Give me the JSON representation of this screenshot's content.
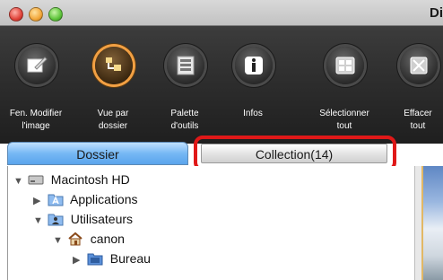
{
  "window": {
    "title": "Di"
  },
  "toolbar": {
    "items": [
      {
        "label": "Fen. Modifier\nl'image",
        "icon": "edit-image-icon"
      },
      {
        "label": "Vue par\ndossier",
        "icon": "folder-view-icon"
      },
      {
        "label": "Palette\nd'outils",
        "icon": "tool-palette-icon"
      },
      {
        "label": "Infos",
        "icon": "info-icon"
      },
      {
        "label": "Sélectionner\ntout",
        "icon": "select-all-icon"
      },
      {
        "label": "Effacer\ntout",
        "icon": "clear-all-icon"
      }
    ]
  },
  "tabs": [
    {
      "label": "Dossier"
    },
    {
      "label": "Collection(14)"
    }
  ],
  "tree": [
    {
      "label": "Macintosh HD",
      "icon": "hard-drive-icon",
      "expanded": true
    },
    {
      "label": "Applications",
      "icon": "applications-folder-icon",
      "expanded": false
    },
    {
      "label": "Utilisateurs",
      "icon": "users-folder-icon",
      "expanded": true
    },
    {
      "label": "canon",
      "icon": "home-icon",
      "expanded": true
    },
    {
      "label": "Bureau",
      "icon": "desktop-folder-icon",
      "expanded": false
    }
  ],
  "colors": {
    "highlight": "#e01818",
    "active_tab": "#76b8f4",
    "active_tool_ring": "#f2a043"
  }
}
